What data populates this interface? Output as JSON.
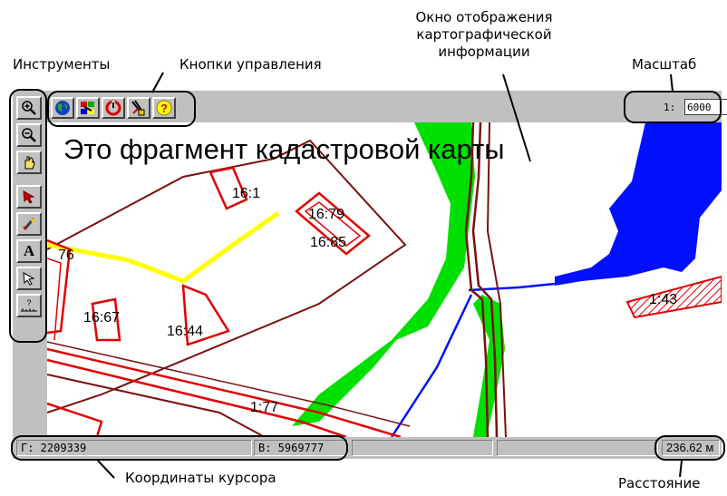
{
  "annotations": {
    "tools": "Инструменты",
    "control_buttons": "Кнопки управления",
    "map_window": "Окно отображения картографической информации",
    "map_window_lines": [
      "Окно отображения",
      "картографической",
      "информации"
    ],
    "scale": "Масштаб",
    "cursor_coords": "Координаты курсора",
    "distance": "Расстояние"
  },
  "toolbar": {
    "buttons": [
      {
        "icon": "globe-icon"
      },
      {
        "icon": "layers-icon"
      },
      {
        "icon": "refresh-icon"
      },
      {
        "icon": "settings-icon"
      },
      {
        "icon": "help-icon",
        "glyph": "?"
      }
    ],
    "scale_prefix": "1:",
    "scale_value": "6000"
  },
  "tools": [
    {
      "icon": "zoom-in-icon"
    },
    {
      "icon": "zoom-out-icon"
    },
    {
      "icon": "hand-pan-icon"
    },
    {
      "icon": "select-arrow-icon"
    },
    {
      "icon": "draw-pen-icon"
    },
    {
      "icon": "text-tool-icon",
      "glyph": "A"
    },
    {
      "icon": "pointer-outline-icon"
    },
    {
      "icon": "ruler-icon",
      "glyph": "?"
    }
  ],
  "map": {
    "title": "Это фрагмент кадастровой карты",
    "parcels": [
      "16:1",
      "16:79",
      "16:85",
      "16:67",
      "16:44",
      "1:77",
      "1:43",
      "76"
    ]
  },
  "status": {
    "x_label": "Г: 2209339",
    "y_label": "В: 5969777",
    "distance": "236.62 м"
  },
  "colors": {
    "panel": "#c0c0c0",
    "parcel": "#e00000",
    "road": "#7a1010",
    "vegetation": "#00e000",
    "water": "#0010ff",
    "highlight": "#ffff00"
  }
}
